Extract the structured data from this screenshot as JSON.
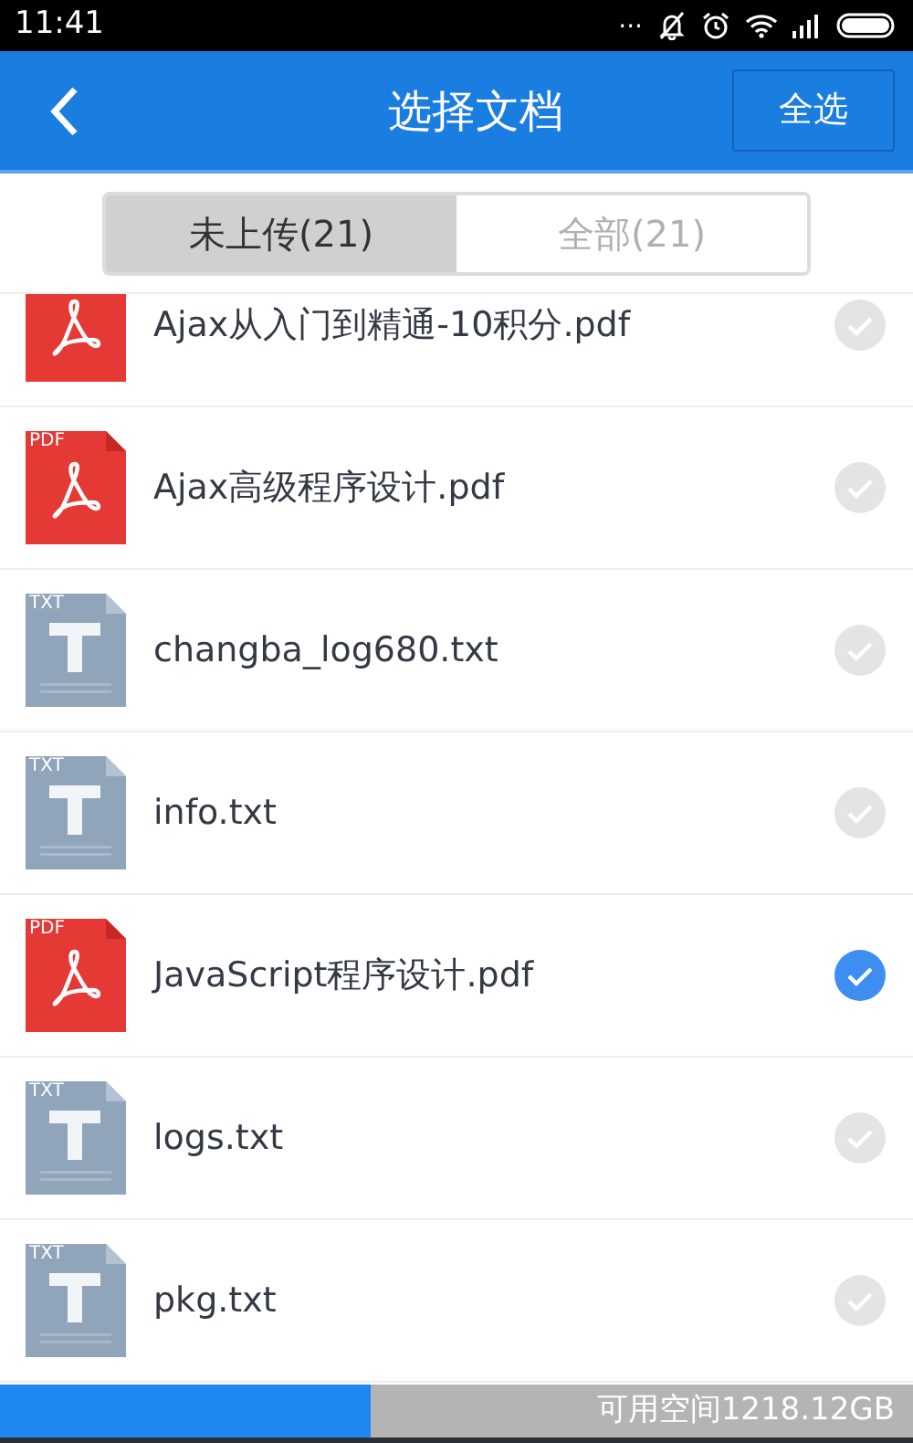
{
  "status_bar": {
    "time": "11:41",
    "dots": "..."
  },
  "header": {
    "title": "选择文档",
    "select_all": "全选"
  },
  "tabs": [
    {
      "label": "未上传(21)",
      "selected": true
    },
    {
      "label": "全部(21)",
      "selected": false
    }
  ],
  "files": [
    {
      "name": "Ajax从入门到精通-10积分.pdf",
      "kind": "pdf",
      "selected": false
    },
    {
      "name": "Ajax高级程序设计.pdf",
      "kind": "pdf",
      "type_label": "PDF",
      "selected": false
    },
    {
      "name": "changba_log680.txt",
      "kind": "txt",
      "type_label": "TXT",
      "selected": false
    },
    {
      "name": "info.txt",
      "kind": "txt",
      "type_label": "TXT",
      "selected": false
    },
    {
      "name": "JavaScript程序设计.pdf",
      "kind": "pdf",
      "type_label": "PDF",
      "selected": true
    },
    {
      "name": "logs.txt",
      "kind": "txt",
      "type_label": "TXT",
      "selected": false
    },
    {
      "name": "pkg.txt",
      "kind": "txt",
      "type_label": "TXT",
      "selected": false
    }
  ],
  "storage": {
    "level": 0.406,
    "label": "可用空间1218.12GB"
  }
}
